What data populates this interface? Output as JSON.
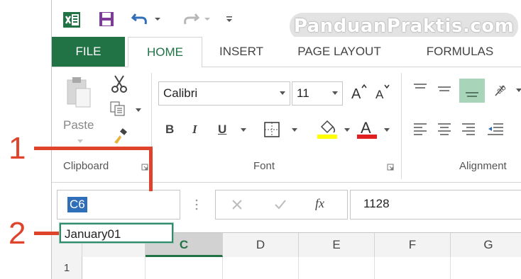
{
  "watermark": "PanduanPraktis.com",
  "tabs": [
    {
      "label": "FILE"
    },
    {
      "label": "HOME"
    },
    {
      "label": "INSERT"
    },
    {
      "label": "PAGE LAYOUT"
    },
    {
      "label": "FORMULAS"
    }
  ],
  "clipboard": {
    "paste_label": "Paste",
    "group_label": "Clipboard"
  },
  "font": {
    "family": "Calibri",
    "size": "11",
    "group_label": "Font",
    "bold": "B",
    "italic": "I",
    "underline": "U"
  },
  "alignment": {
    "group_label": "Alignment"
  },
  "formula_bar": {
    "name_box": "C6",
    "fx_label": "fx",
    "value": "1128"
  },
  "name_entry": "January01",
  "columns": [
    "C",
    "D",
    "E",
    "F",
    "G"
  ],
  "rows": [
    "1"
  ],
  "annotations": [
    "1",
    "2"
  ],
  "colors": {
    "excel_green": "#217346",
    "annotation_red": "#e0432b",
    "selection_blue": "#2f6fba"
  }
}
